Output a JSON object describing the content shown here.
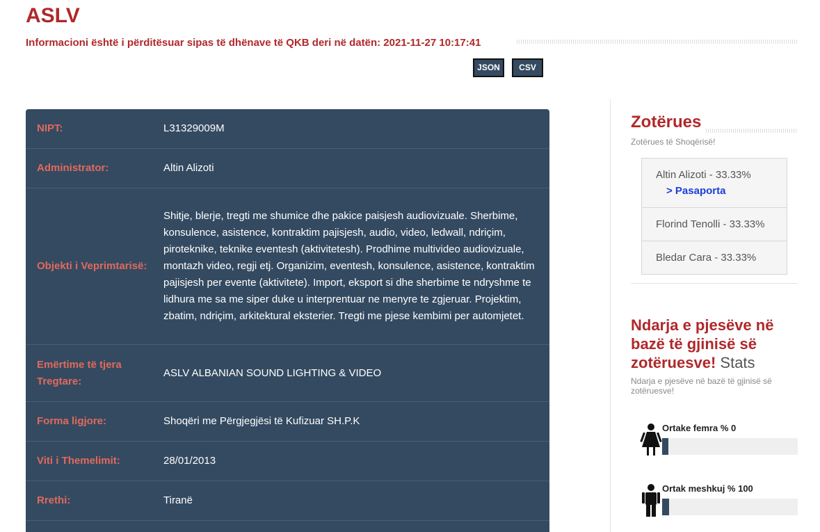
{
  "page": {
    "title": "ASLV",
    "update_notice": "Informacioni është i përditësuar sipas të dhënave të QKB deri në datën: 2021-11-27 10:17:41"
  },
  "export": {
    "json_label": "JSON",
    "csv_label": "CSV"
  },
  "details": {
    "rows": [
      {
        "label": "NIPT:",
        "value": "L31329009M"
      },
      {
        "label": "Administrator:",
        "value": "Altin Alizoti"
      },
      {
        "label": "Objekti i Veprimtarisë:",
        "value": "Shitje, blerje, tregti me shumice dhe pakice paisjesh audiovizuale. Sherbime, konsulence, asistence, kontraktim pajisjesh, audio, video, ledwall, ndriçim, piroteknike, teknike eventesh (aktivitetesh). Prodhime multivideo audiovizuale, montazh video, regji etj. Organizim, eventesh, konsulence, asistence, kontraktim pajisjesh per evente (aktivitete). Import, eksport si dhe sherbime te ndryshme te lidhura me sa me siper duke u interprentuar ne menyre te zgjeruar. Projektim, zbatim, ndriçim, arkitektural eksterier. Tregti me pjese kembimi per automjetet."
      },
      {
        "label": "Emërtime të tjera Tregtare:",
        "value": "ASLV ALBANIAN SOUND LIGHTING & VIDEO"
      },
      {
        "label": "Forma ligjore:",
        "value": "Shoqëri me Përgjegjësi të Kufizuar SH.P.K"
      },
      {
        "label": "Viti i Themelimit:",
        "value": "28/01/2013"
      },
      {
        "label": "Rrethi:",
        "value": "Tiranë"
      }
    ]
  },
  "owners": {
    "title": "Zotërues",
    "subtitle": "Zotërues të Shoqërisë!",
    "items": [
      {
        "name": "Altin Alizoti - 33.33%",
        "link": "> Pasaporta"
      },
      {
        "name": "Florind Tenolli - 33.33%"
      },
      {
        "name": "Bledar Cara - 33.33%"
      }
    ]
  },
  "gender": {
    "title": "Ndarja e pjesëve në bazë të gjinisë së zotëruesve!",
    "stats_label": "Stats",
    "subtitle": "Ndarja e pjesëve në bazë të gjinisë së zotëruesve!",
    "female": {
      "label": "Ortake femra % 0",
      "percent": 0
    },
    "male": {
      "label": "Ortak meshkuj % 100",
      "percent": 100
    }
  },
  "icons": {
    "female": "female-figure-icon",
    "male": "male-figure-icon"
  },
  "colors": {
    "accent": "#b0282a",
    "table_bg": "#344a61",
    "label_color": "#e06a5c",
    "link": "#1a3ed8"
  }
}
